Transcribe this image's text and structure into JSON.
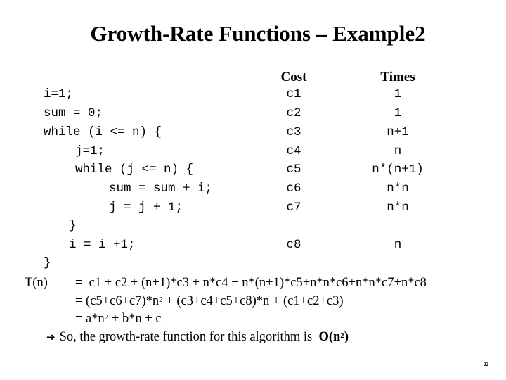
{
  "slide": {
    "title": "Growth-Rate Functions – Example2",
    "page_number": "22"
  },
  "table": {
    "cost_header": "Cost",
    "times_header": "Times"
  },
  "code_lines": [
    {
      "code": "i=1;",
      "cost": "c1",
      "times": "1"
    },
    {
      "code": "sum = 0;",
      "cost": "c2",
      "times": "1"
    },
    {
      "code": "while (i <= n) {",
      "cost": "c3",
      "times": "n+1"
    },
    {
      "code": "j=1;",
      "cost": "c4",
      "times": "n"
    },
    {
      "code": "while (j <= n) {",
      "cost": "c5",
      "times": "n*(n+1)"
    },
    {
      "code": "sum = sum + i;",
      "cost": "c6",
      "times": "n*n"
    },
    {
      "code": "j = j + 1;",
      "cost": "c7",
      "times": "n*n"
    },
    {
      "code": "}",
      "cost": "",
      "times": ""
    },
    {
      "code": "i = i +1;",
      "cost": "c8",
      "times": "n"
    },
    {
      "code": "}",
      "cost": "",
      "times": ""
    }
  ],
  "analysis": {
    "tn_label": "T(n)",
    "line1": "=  c1 + c2 + (n+1)*c3 + n*c4 + n*(n+1)*c5+n*n*c6+n*n*c7+n*c8",
    "line2_a": "= (c5+c6+c7)*n",
    "line2_sup": "2",
    "line2_b": " + (c3+c4+c5+c8)*n + (c1+c2+c3)",
    "line3_a": "= a*n",
    "line3_sup": "2",
    "line3_b": " + b*n + c",
    "conclusion_arrow": "➔",
    "conclusion_text": "So, the growth-rate function for this algorithm is ",
    "conclusion_result_a": "O(n",
    "conclusion_result_sup": "2",
    "conclusion_result_b": ")"
  }
}
